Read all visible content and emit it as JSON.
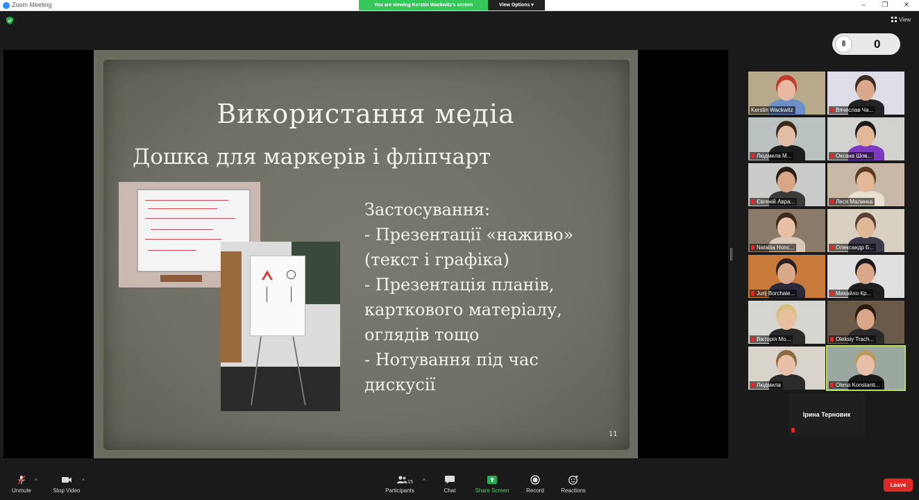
{
  "window": {
    "title": "Zoom Meeting",
    "share_banner": "You are viewing Kerstin Wackwitz's screen",
    "view_options": "View Options",
    "minimize": "–",
    "restore": "❐",
    "close": "✕"
  },
  "top": {
    "view_label": "View",
    "reaction_count": "0"
  },
  "slide": {
    "title": "Використання медіа",
    "subtitle": "Дошка для маркерів і фліпчарт",
    "body": [
      "Застосування:",
      "- Презентації «наживо»",
      "(текст і графіка)",
      "- Презентація планів,",
      "карткового матеріалу,",
      "оглядів тощо",
      "- Нотування під час",
      "дискусії"
    ],
    "page_number": "11"
  },
  "participants": [
    {
      "name": "Kerstin Wackwitz",
      "muted": false,
      "bg": "#b7a98a",
      "head": "#e8b9a0",
      "hair": "#c0392b",
      "shirt": "#6d8fc7",
      "active": false
    },
    {
      "name": "Вячеслав Ча...",
      "muted": true,
      "bg": "#dcdde6",
      "head": "#d9a88a",
      "hair": "#3b2a20",
      "shirt": "#222",
      "active": false
    },
    {
      "name": "Людмила М...",
      "muted": true,
      "bg": "#b9c2c0",
      "head": "#e0bfa5",
      "hair": "#3a2a1a",
      "shirt": "#1e1e1e",
      "active": false
    },
    {
      "name": "Оксана Шов...",
      "muted": true,
      "bg": "#d2d2cf",
      "head": "#e2b898",
      "hair": "#1a1a1a",
      "shirt": "#7c3ac2",
      "active": false
    },
    {
      "name": "Євгеній Авра...",
      "muted": true,
      "bg": "#c9ccc8",
      "head": "#d7a686",
      "hair": "#2a1f15",
      "shirt": "#3a3a3a",
      "active": false
    },
    {
      "name": "Леся Малинка",
      "muted": true,
      "bg": "#c7b8a8",
      "head": "#e2b898",
      "hair": "#5a3a20",
      "shirt": "#e8e0d0",
      "active": false
    },
    {
      "name": "Nataliia Honc...",
      "muted": true,
      "bg": "#8a7a6a",
      "head": "#e8c0a8",
      "hair": "#3a2a1a",
      "shirt": "#d8c8b8",
      "active": false
    },
    {
      "name": "Олександр Б...",
      "muted": true,
      "bg": "#d8d0c0",
      "head": "#e0b898",
      "hair": "#5a4030",
      "shirt": "#3a3a4a",
      "active": false
    },
    {
      "name": "Jurij Borchale...",
      "muted": true,
      "bg": "#c87a3a",
      "head": "#d9a98a",
      "hair": "#2a2020",
      "shirt": "#2a2a3a",
      "active": false
    },
    {
      "name": "Михайло Кр...",
      "muted": true,
      "bg": "#e0e0e0",
      "head": "#d8a888",
      "hair": "#1a1a1a",
      "shirt": "#1e1e1e",
      "active": false
    },
    {
      "name": "Вікторія Мо...",
      "muted": true,
      "bg": "#d6d6d0",
      "head": "#e8c0a0",
      "hair": "#d8c080",
      "shirt": "#2a2a2a",
      "active": false
    },
    {
      "name": "Oleksiy Trach...",
      "muted": true,
      "bg": "#6a5a4a",
      "head": "#d8a888",
      "hair": "#2a1a10",
      "shirt": "#2a2a2a",
      "active": false
    },
    {
      "name": "Людмила",
      "muted": true,
      "bg": "#d8d4cc",
      "head": "#e8c0a8",
      "hair": "#8a6a40",
      "shirt": "#2a2a2a",
      "active": false
    },
    {
      "name": "Olena Konstanti...",
      "muted": true,
      "bg": "#9aa8a0",
      "head": "#e8c0a8",
      "hair": "#b89a60",
      "shirt": "#1a1a1a",
      "active": true
    }
  ],
  "audio_only": {
    "name": "Ірина Терновик"
  },
  "toolbar": {
    "unmute": "Unmute",
    "stop_video": "Stop Video",
    "participants": "Participants",
    "participants_count": "15",
    "chat": "Chat",
    "share_screen": "Share Screen",
    "record": "Record",
    "reactions": "Reactions",
    "leave": "Leave"
  }
}
